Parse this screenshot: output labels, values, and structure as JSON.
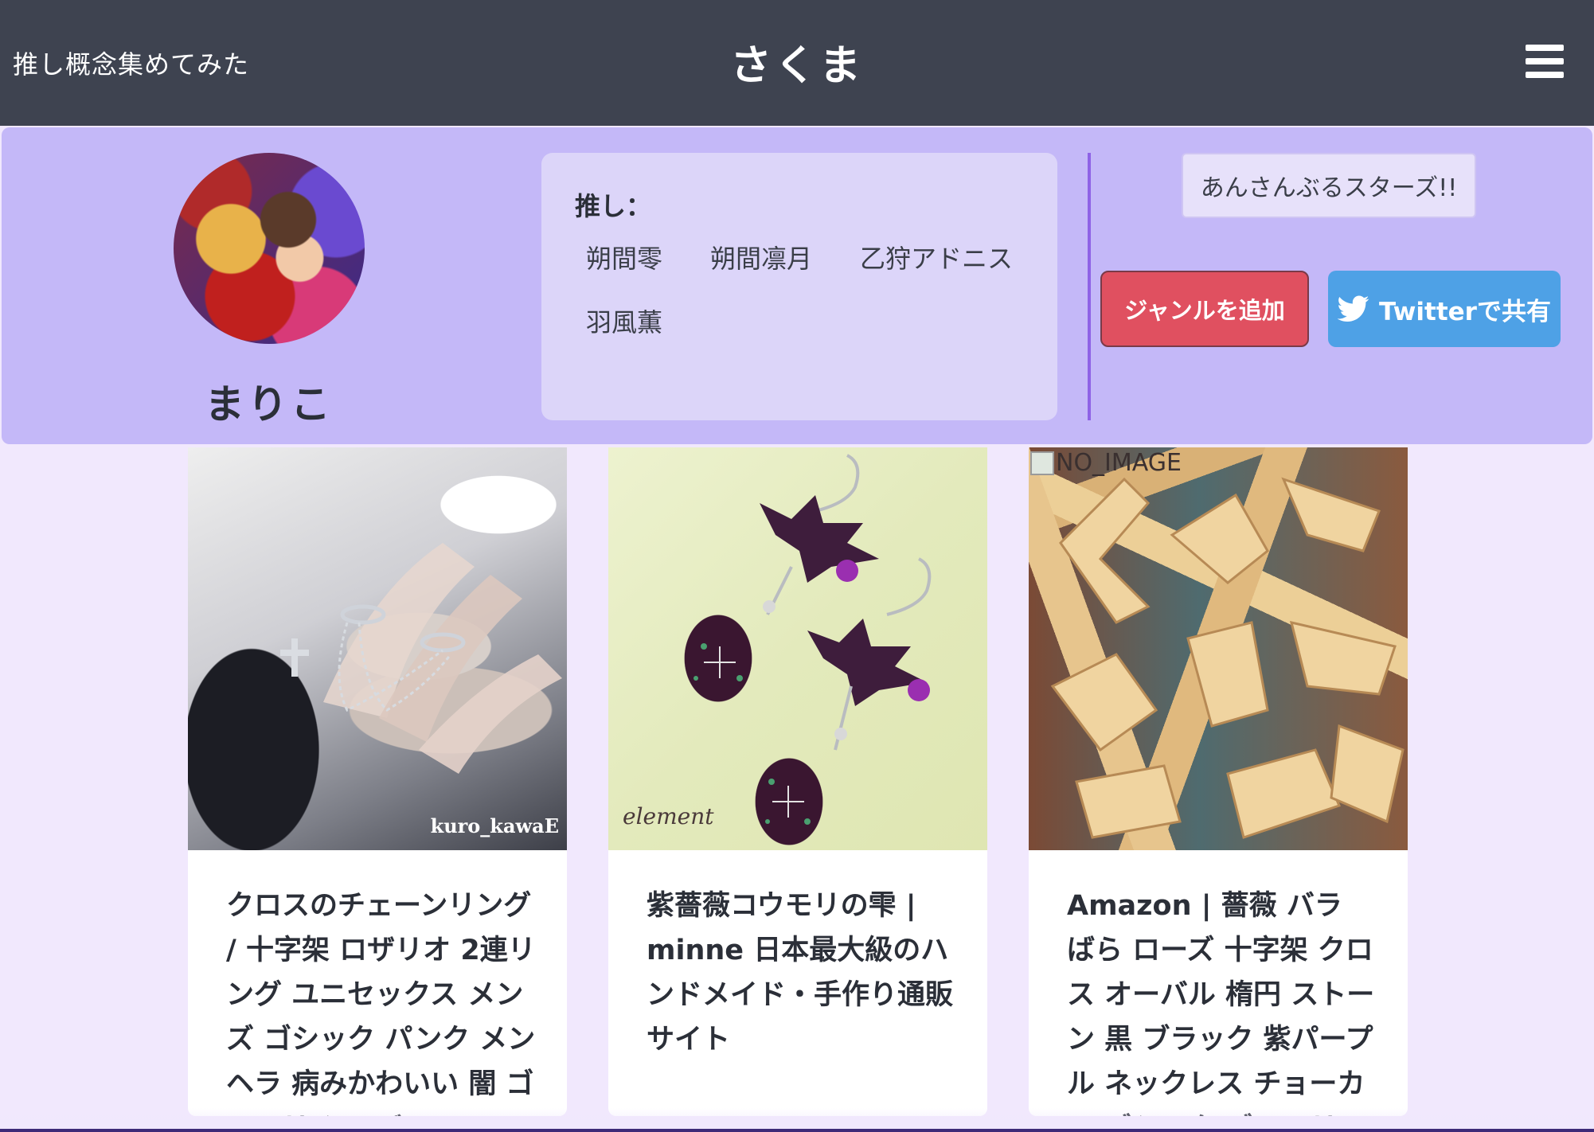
{
  "header": {
    "brand": "推し概念集めてみた",
    "title": "さくま",
    "menu_icon": "hamburger-menu-icon"
  },
  "profile": {
    "username": "まりこ",
    "avatar_alt": "avatar",
    "oshi_label": "推し：",
    "oshi": [
      "朔間零",
      "朔間凛月",
      "乙狩アドニス",
      "羽風薫"
    ],
    "genre": "あんさんぶるスターズ!!",
    "add_genre_label": "ジャンルを追加",
    "share_label": "Twitterで共有",
    "colors": {
      "add_genre": "#e05060",
      "twitter": "#4ea1e6",
      "panel": "#c4b8f8"
    }
  },
  "cards": [
    {
      "title": "クロスのチェーンリング / 十字架 ロザリオ 2連リング ユニセックス メンズ ゴシック パンク メンヘラ 病みかわいい 闇 ゴスロリ シルバー",
      "watermark": "kuro_kawaE"
    },
    {
      "title": "紫薔薇コウモリの雫 | minne 日本最大級のハンドメイド・手作り通販サイト",
      "watermark": "element"
    },
    {
      "title": "Amazon | 薔薇 バラ ばら ローズ 十字架 クロス オーバル 楕円 ストーン 黒 ブラック 紫パープル ネックレス チョーカー ゴシック ゴスロリ",
      "image_alt": "NO_IMAGE"
    }
  ]
}
